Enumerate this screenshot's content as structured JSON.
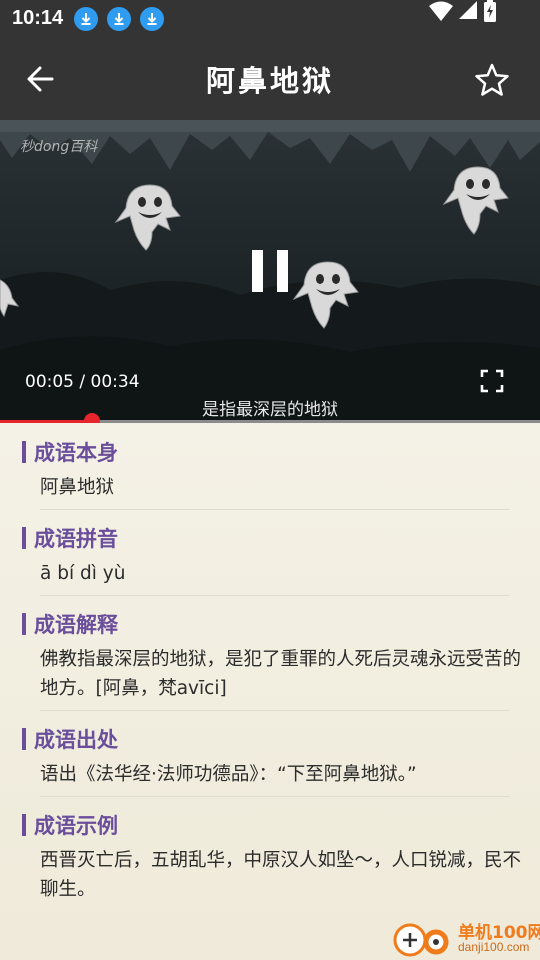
{
  "status_bar": {
    "time": "10:14",
    "download_notifications": 3
  },
  "app_bar": {
    "title": "阿鼻地狱"
  },
  "video": {
    "watermark": "秒dong百科",
    "time_display": "00:05 / 00:34",
    "progress_fraction": 0.17,
    "subtitle": "是指最深层的地狱"
  },
  "colors": {
    "accent": "#6a4e9c",
    "progress": "#e6262c",
    "bar_bg": "#343434"
  },
  "sections": [
    {
      "title": "成语本身",
      "body": "阿鼻地狱"
    },
    {
      "title": "成语拼音",
      "body": "ā bí dì yù"
    },
    {
      "title": "成语解释",
      "body": "佛教指最深层的地狱，是犯了重罪的人死后灵魂永远受苦的地方。[阿鼻，梵avīci]"
    },
    {
      "title": "成语出处",
      "body": "语出《法华经·法师功德品》：“下至阿鼻地狱。”"
    },
    {
      "title": "成语示例",
      "body": "西晋灭亡后，五胡乱华，中原汉人如坠～，人口锐减，民不聊生。"
    }
  ],
  "brand": {
    "name": "单机100网",
    "url": "danji100.com"
  }
}
